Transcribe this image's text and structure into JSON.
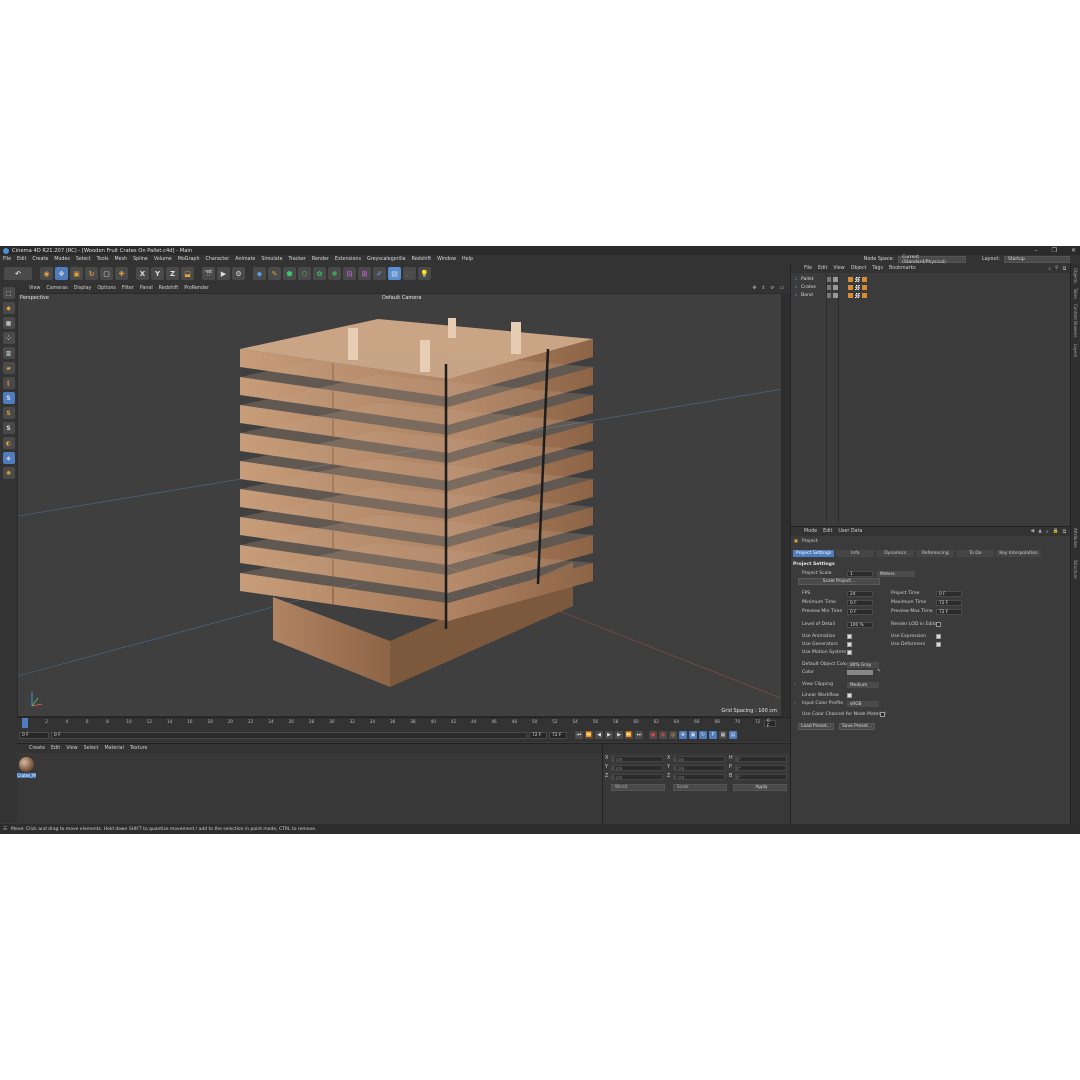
{
  "window": {
    "title": "Cinema 4D R21.207 (RC) - [Wooden Fruit Crates On Pallet.c4d] - Main"
  },
  "menubar": {
    "items": [
      "File",
      "Edit",
      "Create",
      "Modes",
      "Select",
      "Tools",
      "Mesh",
      "Spline",
      "Volume",
      "MoGraph",
      "Character",
      "Animate",
      "Simulate",
      "Tracker",
      "Render",
      "Extensions",
      "Greyscalegorilla",
      "Redshift",
      "Window",
      "Help"
    ],
    "node_space_label": "Node Space:",
    "node_space_value": "Current (Standard/Physical)",
    "layout_label": "Layout:",
    "layout_value": "Startup"
  },
  "toolbar": {
    "axis": [
      "X",
      "Y",
      "Z"
    ]
  },
  "viewport": {
    "menu": [
      "View",
      "Cameras",
      "Display",
      "Options",
      "Filter",
      "Panel",
      "Redshift",
      "ProRender"
    ],
    "label": "Perspective",
    "camera": "Default Camera",
    "grid_spacing": "Grid Spacing : 100 cm"
  },
  "timeline": {
    "ticks": [
      "0",
      "2",
      "4",
      "6",
      "8",
      "10",
      "12",
      "14",
      "16",
      "18",
      "20",
      "22",
      "24",
      "26",
      "28",
      "30",
      "32",
      "34",
      "36",
      "38",
      "40",
      "42",
      "44",
      "46",
      "48",
      "50",
      "52",
      "54",
      "56",
      "58",
      "60",
      "62",
      "64",
      "66",
      "68",
      "70",
      "72"
    ],
    "end_field": "0 F",
    "current": "0 F",
    "start": "0 F",
    "max1": "72 F",
    "max2": "72 F"
  },
  "material_manager": {
    "menu": [
      "Create",
      "Edit",
      "View",
      "Select",
      "Material",
      "Texture"
    ],
    "material_name": "Crates_M"
  },
  "coordinates": {
    "rows": [
      {
        "axis": "X",
        "a": "0 cm",
        "b_axis": "X",
        "b": "0 cm",
        "c_axis": "H",
        "c": "0°"
      },
      {
        "axis": "Y",
        "a": "0 cm",
        "b_axis": "Y",
        "b": "0 cm",
        "c_axis": "P",
        "c": "0°"
      },
      {
        "axis": "Z",
        "a": "0 cm",
        "b_axis": "Z",
        "b": "0 cm",
        "c_axis": "B",
        "c": "0°"
      }
    ],
    "mode1": "World",
    "mode2": "Scale",
    "apply": "Apply"
  },
  "object_manager": {
    "menu": [
      "File",
      "Edit",
      "View",
      "Object",
      "Tags",
      "Bookmarks"
    ],
    "objects": [
      {
        "name": "Pallet"
      },
      {
        "name": "Crates"
      },
      {
        "name": "Band"
      }
    ]
  },
  "attributes": {
    "menu": [
      "Mode",
      "Edit",
      "User Data"
    ],
    "object": "Project",
    "tabs": [
      "Project Settings",
      "Info",
      "Dynamics",
      "Referencing",
      "To Do",
      "Key Interpolation"
    ],
    "section": "Project Settings",
    "project_scale_label": "Project Scale",
    "project_scale_value": "1",
    "project_scale_unit": "Meters",
    "scale_project_btn": "Scale Project...",
    "fps_label": "FPS",
    "fps": "24",
    "project_time_label": "Project Time",
    "project_time": "0 F",
    "min_time_label": "Minimum Time",
    "min_time": "0 F",
    "max_time_label": "Maximum Time",
    "max_time": "72 F",
    "prev_min_label": "Preview Min Time",
    "prev_min": "0 F",
    "prev_max_label": "Preview Max Time",
    "prev_max": "72 F",
    "lod_label": "Level of Detail",
    "lod": "100 %",
    "render_lod_label": "Render LOD in Editor",
    "use_animation": "Use Animation",
    "use_expression": "Use Expression",
    "use_generators": "Use Generators",
    "use_deformers": "Use Deformers",
    "use_motion": "Use Motion System",
    "default_color_label": "Default Object Color",
    "default_color_value": "80% Gray",
    "color_label": "Color",
    "view_clipping_label": "View Clipping",
    "view_clipping_value": "Medium",
    "linear_workflow_label": "Linear Workflow",
    "input_color_label": "Input Color Profile",
    "input_color_value": "sRGB",
    "color_channel_label": "Use Color Channel for Node Material",
    "load_preset": "Load Preset...",
    "save_preset": "Save Preset..."
  },
  "side_tabs": [
    "Objects",
    "Takes",
    "Content Browser",
    "Layers",
    "Attributes",
    "Structure"
  ],
  "status": {
    "text": "Move: Click and drag to move elements. Hold down SHIFT to quantize movement / add to the selection in point mode, CTRL to remove."
  },
  "colors": {
    "accent": "#4f7cbd",
    "background": "#3b3b3b",
    "wood": "#b58867"
  }
}
